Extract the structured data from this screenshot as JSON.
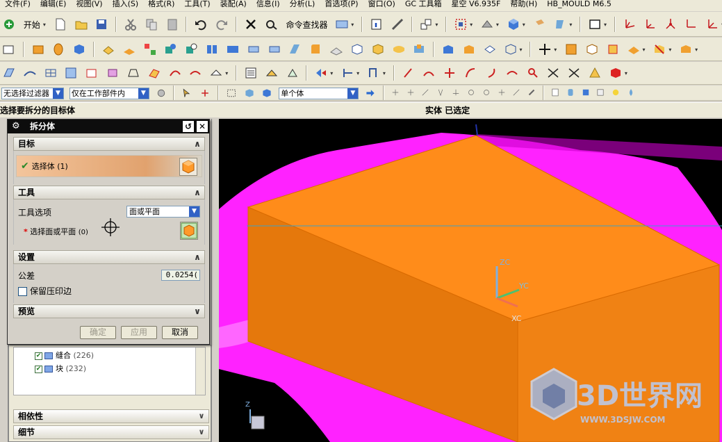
{
  "menu": [
    "文件(F)",
    "编辑(E)",
    "视图(V)",
    "插入(S)",
    "格式(R)",
    "工具(T)",
    "装配(A)",
    "信息(I)",
    "分析(L)",
    "首选项(P)",
    "窗口(O)",
    "GC 工具箱",
    "星空 V6.935F",
    "帮助(H)",
    "HB_MOULD M6.5"
  ],
  "toolbar1": {
    "start_label": "开始",
    "command_finder_label": "命令查找器"
  },
  "selection_bar": {
    "filter_value": "无选择过滤器",
    "scope_value": "仅在工作部件内",
    "body_value": "单个体"
  },
  "cue": {
    "prompt": "选择要拆分的目标体",
    "status": "实体 已选定"
  },
  "dialog": {
    "title": "拆分体",
    "target_section": "目标",
    "select_body_label": "选择体",
    "select_body_count": "(1)",
    "tool_section": "工具",
    "tool_option_label": "工具选项",
    "tool_option_value": "面或平面",
    "select_face_label": "选择面或平面",
    "select_face_count": "(0)",
    "settings_section": "设置",
    "tolerance_label": "公差",
    "tolerance_value": "0.0254(",
    "keep_imprint_label": "保留压印边",
    "preview_section": "预览",
    "ok_label": "确定",
    "apply_label": "应用",
    "cancel_label": "取消"
  },
  "navigator": {
    "tree_items": [
      {
        "label": "缝合",
        "count": "(226)"
      },
      {
        "label": "块",
        "count": "(232)"
      }
    ],
    "dependency_label": "相依性",
    "details_label": "细节"
  },
  "viewport": {
    "axis_zc": "ZC",
    "axis_yc": "YC",
    "axis_xc": "XC",
    "axis_z": "Z",
    "watermark_title": "3D世界网",
    "watermark_url": "WWW.3DSJW.COM",
    "colors": {
      "background": "#000000",
      "solid": "#ff8c1a",
      "surface": "#ff22ff"
    }
  }
}
